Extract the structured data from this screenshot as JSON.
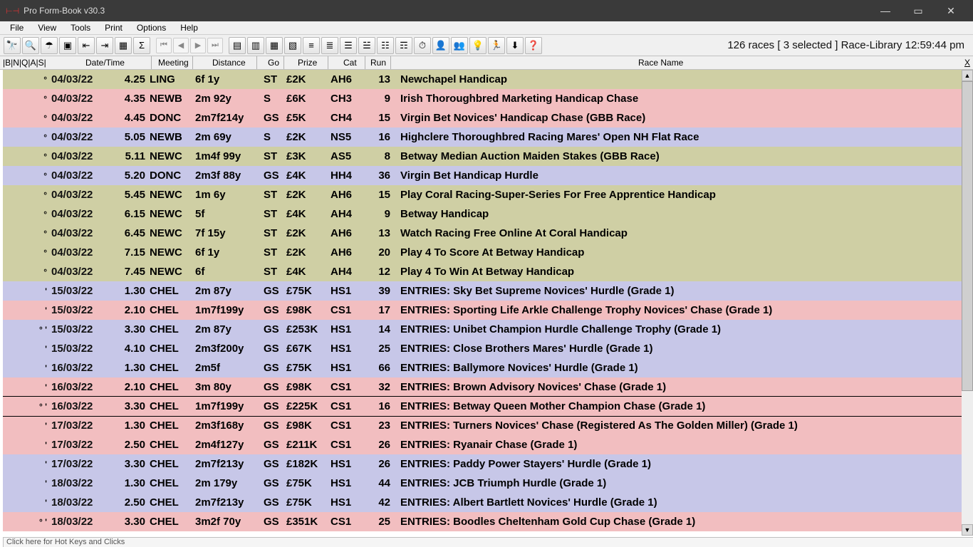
{
  "window": {
    "title": "Pro Form-Book v30.3"
  },
  "menu": [
    "File",
    "View",
    "Tools",
    "Print",
    "Options",
    "Help"
  ],
  "toolbar_icons": [
    "binoculars",
    "magnifier",
    "umbrella",
    "window",
    "width-left",
    "width-right",
    "grid",
    "sigma"
  ],
  "nav_icons": [
    "first",
    "prev",
    "next",
    "last"
  ],
  "toolbar_icons2": [
    "cal1",
    "cal2",
    "cal3",
    "cal4",
    "sep1",
    "sep2",
    "sep3",
    "sep4",
    "list1",
    "list2",
    "clock",
    "user",
    "users",
    "bulb",
    "runner",
    "down",
    "help"
  ],
  "status_top": "126 races [ 3 selected ] Race-Library  12:59:44 pm",
  "columns": {
    "flags": "|B|N|Q|A|S|",
    "datetime": "Date/Time",
    "meeting": "Meeting",
    "distance": "Distance",
    "go": "Go",
    "prize": "Prize",
    "cat": "Cat",
    "run": "Run",
    "name": "Race Name",
    "closex": "X"
  },
  "rows": [
    {
      "clr": "green",
      "mk": "°",
      "date": "04/03/22",
      "time": "4.25",
      "meet": "LING",
      "dist": "6f  1y",
      "go": "ST",
      "prize": "£2K",
      "cat": "AH6",
      "run": "13",
      "name": "Newchapel Handicap"
    },
    {
      "clr": "pink",
      "mk": "°",
      "date": "04/03/22",
      "time": "4.35",
      "meet": "NEWB",
      "dist": "2m  92y",
      "go": "S",
      "prize": "£6K",
      "cat": "CH3",
      "run": "9",
      "name": "Irish Thoroughbred Marketing Handicap Chase"
    },
    {
      "clr": "pink",
      "mk": "°",
      "date": "04/03/22",
      "time": "4.45",
      "meet": "DONC",
      "dist": "2m7f214y",
      "go": "GS",
      "prize": "£5K",
      "cat": "CH4",
      "run": "15",
      "name": "Virgin Bet Novices' Handicap Chase (GBB Race)"
    },
    {
      "clr": "lilac",
      "mk": "°",
      "date": "04/03/22",
      "time": "5.05",
      "meet": "NEWB",
      "dist": "2m  69y",
      "go": "S",
      "prize": "£2K",
      "cat": "NS5",
      "run": "16",
      "name": "Highclere Thoroughbred Racing Mares' Open NH Flat Race"
    },
    {
      "clr": "green",
      "mk": "°",
      "date": "04/03/22",
      "time": "5.11",
      "meet": "NEWC",
      "dist": "1m4f 99y",
      "go": "ST",
      "prize": "£3K",
      "cat": "AS5",
      "run": "8",
      "name": "Betway Median Auction Maiden Stakes (GBB Race)"
    },
    {
      "clr": "lilac",
      "mk": "°",
      "date": "04/03/22",
      "time": "5.20",
      "meet": "DONC",
      "dist": "2m3f 88y",
      "go": "GS",
      "prize": "£4K",
      "cat": "HH4",
      "run": "36",
      "name": "Virgin Bet Handicap Hurdle"
    },
    {
      "clr": "green",
      "mk": "°",
      "date": "04/03/22",
      "time": "5.45",
      "meet": "NEWC",
      "dist": "1m    6y",
      "go": "ST",
      "prize": "£2K",
      "cat": "AH6",
      "run": "15",
      "name": "Play Coral Racing-Super-Series For Free Apprentice Handicap"
    },
    {
      "clr": "green",
      "mk": "°",
      "date": "04/03/22",
      "time": "6.15",
      "meet": "NEWC",
      "dist": "5f",
      "go": "ST",
      "prize": "£4K",
      "cat": "AH4",
      "run": "9",
      "name": "Betway Handicap"
    },
    {
      "clr": "green",
      "mk": "°",
      "date": "04/03/22",
      "time": "6.45",
      "meet": "NEWC",
      "dist": "7f 15y",
      "go": "ST",
      "prize": "£2K",
      "cat": "AH6",
      "run": "13",
      "name": "Watch Racing Free Online At Coral Handicap"
    },
    {
      "clr": "green",
      "mk": "°",
      "date": "04/03/22",
      "time": "7.15",
      "meet": "NEWC",
      "dist": "6f  1y",
      "go": "ST",
      "prize": "£2K",
      "cat": "AH6",
      "run": "20",
      "name": "Play 4 To Score At Betway Handicap"
    },
    {
      "clr": "green",
      "mk": "°",
      "date": "04/03/22",
      "time": "7.45",
      "meet": "NEWC",
      "dist": "6f",
      "go": "ST",
      "prize": "£4K",
      "cat": "AH4",
      "run": "12",
      "name": "Play 4 To Win At Betway Handicap"
    },
    {
      "clr": "lilac",
      "mk": "'",
      "date": "15/03/22",
      "time": "1.30",
      "meet": "CHEL",
      "dist": "2m  87y",
      "go": "GS",
      "prize": "£75K",
      "cat": "HS1",
      "run": "39",
      "name": "ENTRIES: Sky Bet Supreme Novices' Hurdle (Grade 1)"
    },
    {
      "clr": "pink",
      "mk": "'",
      "date": "15/03/22",
      "time": "2.10",
      "meet": "CHEL",
      "dist": "1m7f199y",
      "go": "GS",
      "prize": "£98K",
      "cat": "CS1",
      "run": "17",
      "name": "ENTRIES: Sporting Life Arkle Challenge Trophy Novices' Chase (Grade 1)"
    },
    {
      "clr": "lilac",
      "mk": "° '",
      "date": "15/03/22",
      "time": "3.30",
      "meet": "CHEL",
      "dist": "2m  87y",
      "go": "GS",
      "prize": "£253K",
      "cat": "HS1",
      "run": "14",
      "name": "ENTRIES: Unibet Champion Hurdle Challenge Trophy (Grade 1)"
    },
    {
      "clr": "lilac",
      "mk": "'",
      "date": "15/03/22",
      "time": "4.10",
      "meet": "CHEL",
      "dist": "2m3f200y",
      "go": "GS",
      "prize": "£67K",
      "cat": "HS1",
      "run": "25",
      "name": "ENTRIES: Close Brothers Mares' Hurdle (Grade 1)"
    },
    {
      "clr": "lilac",
      "mk": "'",
      "date": "16/03/22",
      "time": "1.30",
      "meet": "CHEL",
      "dist": "2m5f",
      "go": "GS",
      "prize": "£75K",
      "cat": "HS1",
      "run": "66",
      "name": "ENTRIES: Ballymore Novices' Hurdle (Grade 1)"
    },
    {
      "clr": "pink",
      "mk": "'",
      "date": "16/03/22",
      "time": "2.10",
      "meet": "CHEL",
      "dist": "3m  80y",
      "go": "GS",
      "prize": "£98K",
      "cat": "CS1",
      "run": "32",
      "name": "ENTRIES: Brown Advisory Novices' Chase (Grade 1)"
    },
    {
      "clr": "pink",
      "mk": "° '",
      "date": "16/03/22",
      "time": "3.30",
      "meet": "CHEL",
      "dist": "1m7f199y",
      "go": "GS",
      "prize": "£225K",
      "cat": "CS1",
      "run": "16",
      "name": "ENTRIES: Betway Queen Mother Champion Chase (Grade 1)",
      "sel": true
    },
    {
      "clr": "pink",
      "mk": "'",
      "date": "17/03/22",
      "time": "1.30",
      "meet": "CHEL",
      "dist": "2m3f168y",
      "go": "GS",
      "prize": "£98K",
      "cat": "CS1",
      "run": "23",
      "name": "ENTRIES: Turners Novices' Chase (Registered As The Golden Miller) (Grade 1)"
    },
    {
      "clr": "pink",
      "mk": "'",
      "date": "17/03/22",
      "time": "2.50",
      "meet": "CHEL",
      "dist": "2m4f127y",
      "go": "GS",
      "prize": "£211K",
      "cat": "CS1",
      "run": "26",
      "name": "ENTRIES: Ryanair Chase (Grade 1)"
    },
    {
      "clr": "lilac",
      "mk": "'",
      "date": "17/03/22",
      "time": "3.30",
      "meet": "CHEL",
      "dist": "2m7f213y",
      "go": "GS",
      "prize": "£182K",
      "cat": "HS1",
      "run": "26",
      "name": "ENTRIES: Paddy Power Stayers' Hurdle (Grade 1)"
    },
    {
      "clr": "lilac",
      "mk": "'",
      "date": "18/03/22",
      "time": "1.30",
      "meet": "CHEL",
      "dist": "2m 179y",
      "go": "GS",
      "prize": "£75K",
      "cat": "HS1",
      "run": "44",
      "name": "ENTRIES: JCB Triumph Hurdle (Grade 1)"
    },
    {
      "clr": "lilac",
      "mk": "'",
      "date": "18/03/22",
      "time": "2.50",
      "meet": "CHEL",
      "dist": "2m7f213y",
      "go": "GS",
      "prize": "£75K",
      "cat": "HS1",
      "run": "42",
      "name": "ENTRIES: Albert Bartlett Novices' Hurdle (Grade 1)"
    },
    {
      "clr": "pink",
      "mk": "° '",
      "date": "18/03/22",
      "time": "3.30",
      "meet": "CHEL",
      "dist": "3m2f 70y",
      "go": "GS",
      "prize": "£351K",
      "cat": "CS1",
      "run": "25",
      "name": "ENTRIES: Boodles Cheltenham Gold Cup Chase (Grade 1)"
    }
  ],
  "bottom_status": "Click here for Hot Keys and Clicks"
}
